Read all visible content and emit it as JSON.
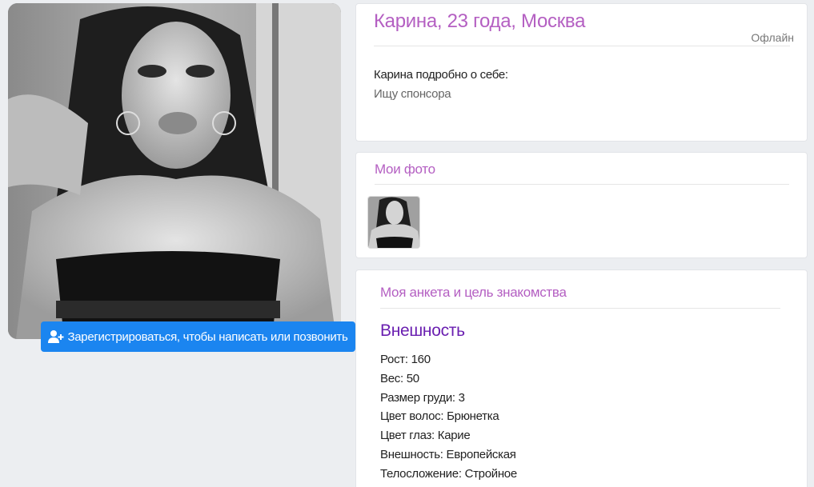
{
  "profile": {
    "title": "Карина, 23 года, Москва",
    "status": "Офлайн",
    "about_label": "Карина подробно о себе:",
    "about_text": "Ищу спонсора"
  },
  "actions": {
    "register_label": "Зарегистрироваться, чтобы написать или позвонить",
    "register_icon": "user-plus-icon",
    "button_color": "#1b85f0"
  },
  "photos": {
    "title": "Мои фото"
  },
  "questionnaire": {
    "title": "Моя анкета и цель знакомства",
    "appearance_heading": "Внешность",
    "attributes": [
      {
        "label": "Рост",
        "value": "160"
      },
      {
        "label": "Вес",
        "value": "50"
      },
      {
        "label": "Размер груди",
        "value": "3"
      },
      {
        "label": "Цвет волос",
        "value": "Брюнетка"
      },
      {
        "label": "Цвет глаз",
        "value": "Карие"
      },
      {
        "label": "Внешность",
        "value": "Европейская"
      },
      {
        "label": "Телосложение",
        "value": "Стройное"
      }
    ]
  },
  "colors": {
    "accent": "#b45fc2",
    "heading": "#6a1fb0",
    "background": "#eceef1"
  }
}
